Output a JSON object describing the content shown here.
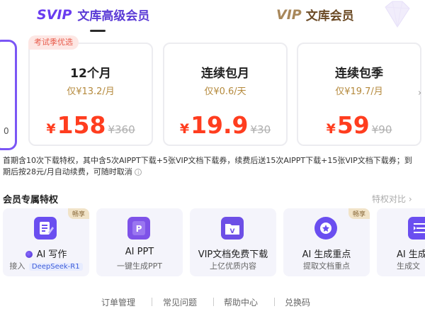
{
  "header": {
    "svip_logo": "SVIP",
    "svip_title": "文库高级会员",
    "vip_logo": "VIP",
    "vip_title": "文库会员"
  },
  "left_partial_char": "0",
  "badge": "考试季优选",
  "plans": [
    {
      "name": "12个月",
      "unit": "仅¥13.2/月",
      "currency": "¥",
      "price": "158",
      "original": "¥360"
    },
    {
      "name": "连续包月",
      "unit": "仅¥0.6/天",
      "currency": "¥",
      "price": "19.9",
      "original": "¥30"
    },
    {
      "name": "连续包季",
      "unit": "仅¥19.7/月",
      "currency": "¥",
      "price": "59",
      "original": "¥90"
    }
  ],
  "next_arrow": "›",
  "description": "首期含10次下载特权，其中含5次AIPPT下载+5张VIP文档下载券，续费后送15次AIPPT下载+15张VIP文档下载券；到期后按28元/月自动续费，可随时取消",
  "info_icon": "i",
  "privileges": {
    "title": "会员专属特权",
    "compare": "特权对比 ›",
    "tiles": [
      {
        "name": "AI 写作",
        "sub_prefix": "接入",
        "sub_tag": "DeepSeek-R1",
        "hot": "畅享",
        "icon_color": "#6a4ef0"
      },
      {
        "name": "AI PPT",
        "sub": "一键生成PPT",
        "icon_color": "#7e52e8"
      },
      {
        "name": "VIP文档免费下载",
        "sub": "上亿优质内容",
        "icon_color": "#6d4fe6"
      },
      {
        "name": "AI 生成重点",
        "sub": "提取文档重点",
        "hot": "畅享",
        "icon_color": "#6a4ef0"
      },
      {
        "name": "AI 生成",
        "sub": "生成文",
        "icon_color": "#6a4ef0"
      }
    ]
  },
  "footer": [
    "订单管理",
    "常见问题",
    "帮助中心",
    "兑换码"
  ],
  "colors": {
    "accent": "#6a3cf0",
    "price": "#ff3d1f",
    "gold": "#b58a3d"
  }
}
